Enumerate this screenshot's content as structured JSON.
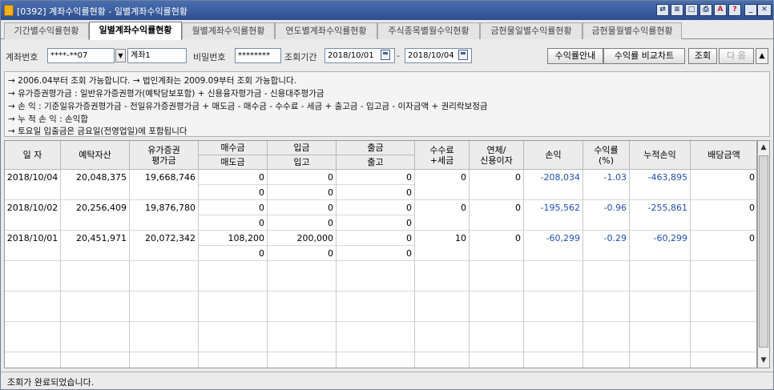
{
  "window": {
    "title": "[0392] 계좌수익률현황 - 일별계좌수익률현황"
  },
  "tabs": [
    {
      "label": "기간별수익률현황",
      "active": false
    },
    {
      "label": "일별계좌수익률현황",
      "active": true
    },
    {
      "label": "월별계좌수익률현황",
      "active": false
    },
    {
      "label": "연도별계좌수익률현황",
      "active": false
    },
    {
      "label": "주식종목별월수익현황",
      "active": false
    },
    {
      "label": "금현물일별수익률현황",
      "active": false
    },
    {
      "label": "금현물월별수익률현황",
      "active": false
    }
  ],
  "search": {
    "account_label": "계좌번호",
    "account_value": "****-**07",
    "account_type": "계좌1",
    "password_label": "비밀번호",
    "password_value": "********",
    "period_label": "조회기간",
    "date_from": "2018/10/01",
    "date_sep": "-",
    "date_to": "2018/10/04",
    "btn_guide": "수익률안내",
    "btn_chart": "수익률 비교차트",
    "btn_query": "조회",
    "btn_next": "다 음"
  },
  "info_lines": [
    "→ 2006.04부터 조회 가능합니다. → 법인계좌는 2009.09부터 조회 가능합니다.",
    "→ 유가증권평가금 : 일반유가증권평가(예탁담보포함) + 신용융자평가금 - 신용대주평가금",
    "→ 손      익 : 기준일유가증권평가금 - 전일유가증권평가금 + 매도금 - 매수금 - 수수료 - 세금 + 출고금 - 입고금 - 이자금액 + 권리락보정금",
    "→ 누 적 손 익 : 손익합",
    "→ 토요일 입출금은 금요일(전영업일)에 포함됩니다"
  ],
  "table": {
    "headers": {
      "date": "일 자",
      "deposit": "예탁자산",
      "securities_1": "유가증권",
      "securities_2": "평가금",
      "buy": "매수금",
      "sell": "매도금",
      "deposit_in": "입금",
      "stock_in": "입고",
      "withdraw": "출금",
      "stock_out": "출고",
      "fee_1": "수수료",
      "fee_2": "+세금",
      "interest_1": "연체/",
      "interest_2": "신용이자",
      "pnl": "손익",
      "rate_1": "수익률",
      "rate_2": "(%)",
      "cum_pnl": "누적손익",
      "dividend": "배당금액"
    },
    "rows": [
      {
        "date": "2018/10/04",
        "deposit": "20,048,375",
        "securities": "19,668,746",
        "buy": "0",
        "sell": "0",
        "deposit_in": "0",
        "stock_in": "0",
        "withdraw": "0",
        "stock_out": "0",
        "fee": "0",
        "interest": "0",
        "pnl": "-208,034",
        "rate": "-1.03",
        "cum_pnl": "-463,895",
        "dividend": "0"
      },
      {
        "date": "2018/10/02",
        "deposit": "20,256,409",
        "securities": "19,876,780",
        "buy": "0",
        "sell": "0",
        "deposit_in": "0",
        "stock_in": "0",
        "withdraw": "0",
        "stock_out": "0",
        "fee": "0",
        "interest": "0",
        "pnl": "-195,562",
        "rate": "-0.96",
        "cum_pnl": "-255,861",
        "dividend": "0"
      },
      {
        "date": "2018/10/01",
        "deposit": "20,451,971",
        "securities": "20,072,342",
        "buy": "108,200",
        "sell": "0",
        "deposit_in": "200,000",
        "stock_in": "0",
        "withdraw": "0",
        "stock_out": "0",
        "fee": "10",
        "interest": "0",
        "pnl": "-60,299",
        "rate": "-0.29",
        "cum_pnl": "-60,299",
        "dividend": "0"
      }
    ]
  },
  "status": {
    "message": "조회가 완료되었습니다."
  },
  "colors": {
    "title_bar": "#2d4f8e",
    "negative_value": "#1f4fa8"
  }
}
